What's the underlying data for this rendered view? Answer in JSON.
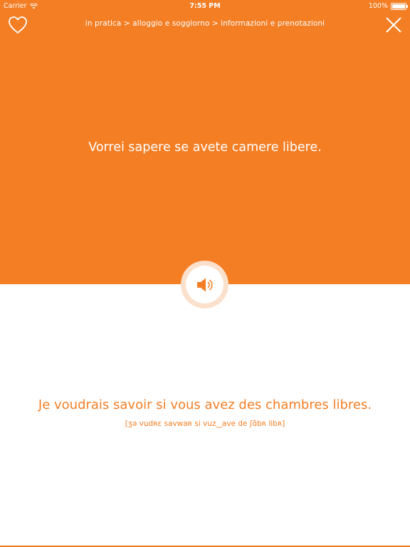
{
  "status_bar": {
    "carrier": "Carrier",
    "time": "7:55 PM",
    "battery": "100%",
    "battery_level": 1.0,
    "wifi_icon": "wifi-icon"
  },
  "header": {
    "favorite_icon": "heart-outline-icon",
    "breadcrumb": "in pratica > alloggio e soggiorno > informazioni e prenotazioni",
    "close_icon": "close-icon"
  },
  "phrase": {
    "source": "Vorrei sapere se avete camere libere.",
    "translation": "Je voudrais savoir si vous avez des chambres libres.",
    "transcription": "[ʒə vudʀɛ savwaʀ si vuz‿ave de ʃɑ̃bʀ libʀ]"
  },
  "audio": {
    "icon": "speaker-icon"
  },
  "colors": {
    "accent": "#f47e24",
    "ring": "#fbe0cb",
    "background": "#ffffff",
    "text_on_accent": "#ffffff"
  }
}
